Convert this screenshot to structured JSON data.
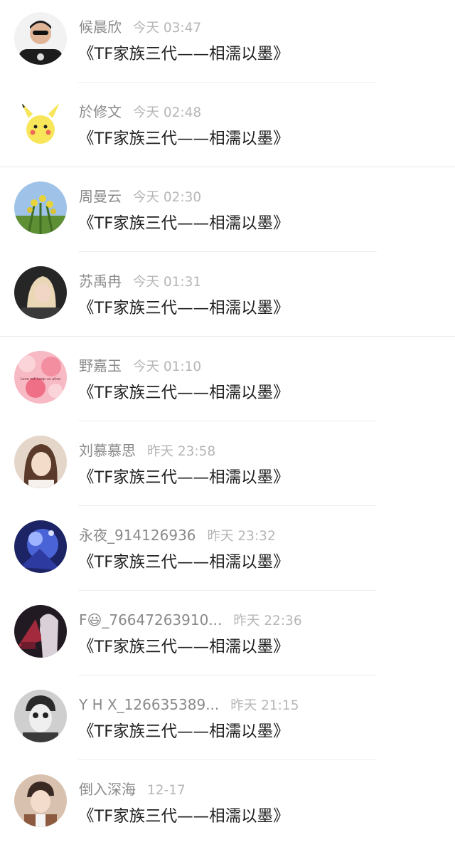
{
  "comments": [
    {
      "name": "候晨欣",
      "time": "今天 03:47",
      "text": "《TF家族三代——相濡以墨》",
      "avatar_icon": "avatar-man-skull-shirt",
      "accent": "#2d2d2d"
    },
    {
      "name": "於修文",
      "time": "今天 02:48",
      "text": "《TF家族三代——相濡以墨》",
      "avatar_icon": "avatar-pikachu",
      "accent": "#f3d23c"
    },
    {
      "name": "周曼云",
      "time": "今天 02:30",
      "text": "《TF家族三代——相濡以墨》",
      "avatar_icon": "avatar-yellow-flowers",
      "accent": "#6e9a3a"
    },
    {
      "name": "苏禹冉",
      "time": "今天 01:31",
      "text": "《TF家族三代——相濡以墨》",
      "avatar_icon": "avatar-blonde-girl",
      "accent": "#2a2a2a"
    },
    {
      "name": "野嘉玉",
      "time": "今天 01:10",
      "text": "《TF家族三代——相濡以墨》",
      "avatar_icon": "avatar-pink-bokeh",
      "accent": "#f08aa0",
      "avatar_caption": "Love will keep us alive"
    },
    {
      "name": "刘慕慕思",
      "time": "昨天 23:58",
      "text": "《TF家族三代——相濡以墨》",
      "avatar_icon": "avatar-girl-portrait",
      "accent": "#d9b39c"
    },
    {
      "name": "永夜_914126936",
      "time": "昨天 23:32",
      "text": "《TF家族三代——相濡以墨》",
      "avatar_icon": "avatar-blue-anime",
      "accent": "#3a4fb8"
    },
    {
      "name": "F😃_76647263910...",
      "time": "昨天 22:36",
      "text": "《TF家族三代——相濡以墨》",
      "avatar_icon": "avatar-dark-anime",
      "accent": "#a03040"
    },
    {
      "name": "Y H X_126635389...",
      "time": "昨天 21:15",
      "text": "《TF家族三代——相濡以墨》",
      "avatar_icon": "avatar-painted-face",
      "accent": "#e8e8e8"
    },
    {
      "name": "倒入深海",
      "time": "12-17",
      "text": "《TF家族三代——相濡以墨》",
      "avatar_icon": "avatar-boy-portrait",
      "accent": "#b27a5a"
    }
  ]
}
